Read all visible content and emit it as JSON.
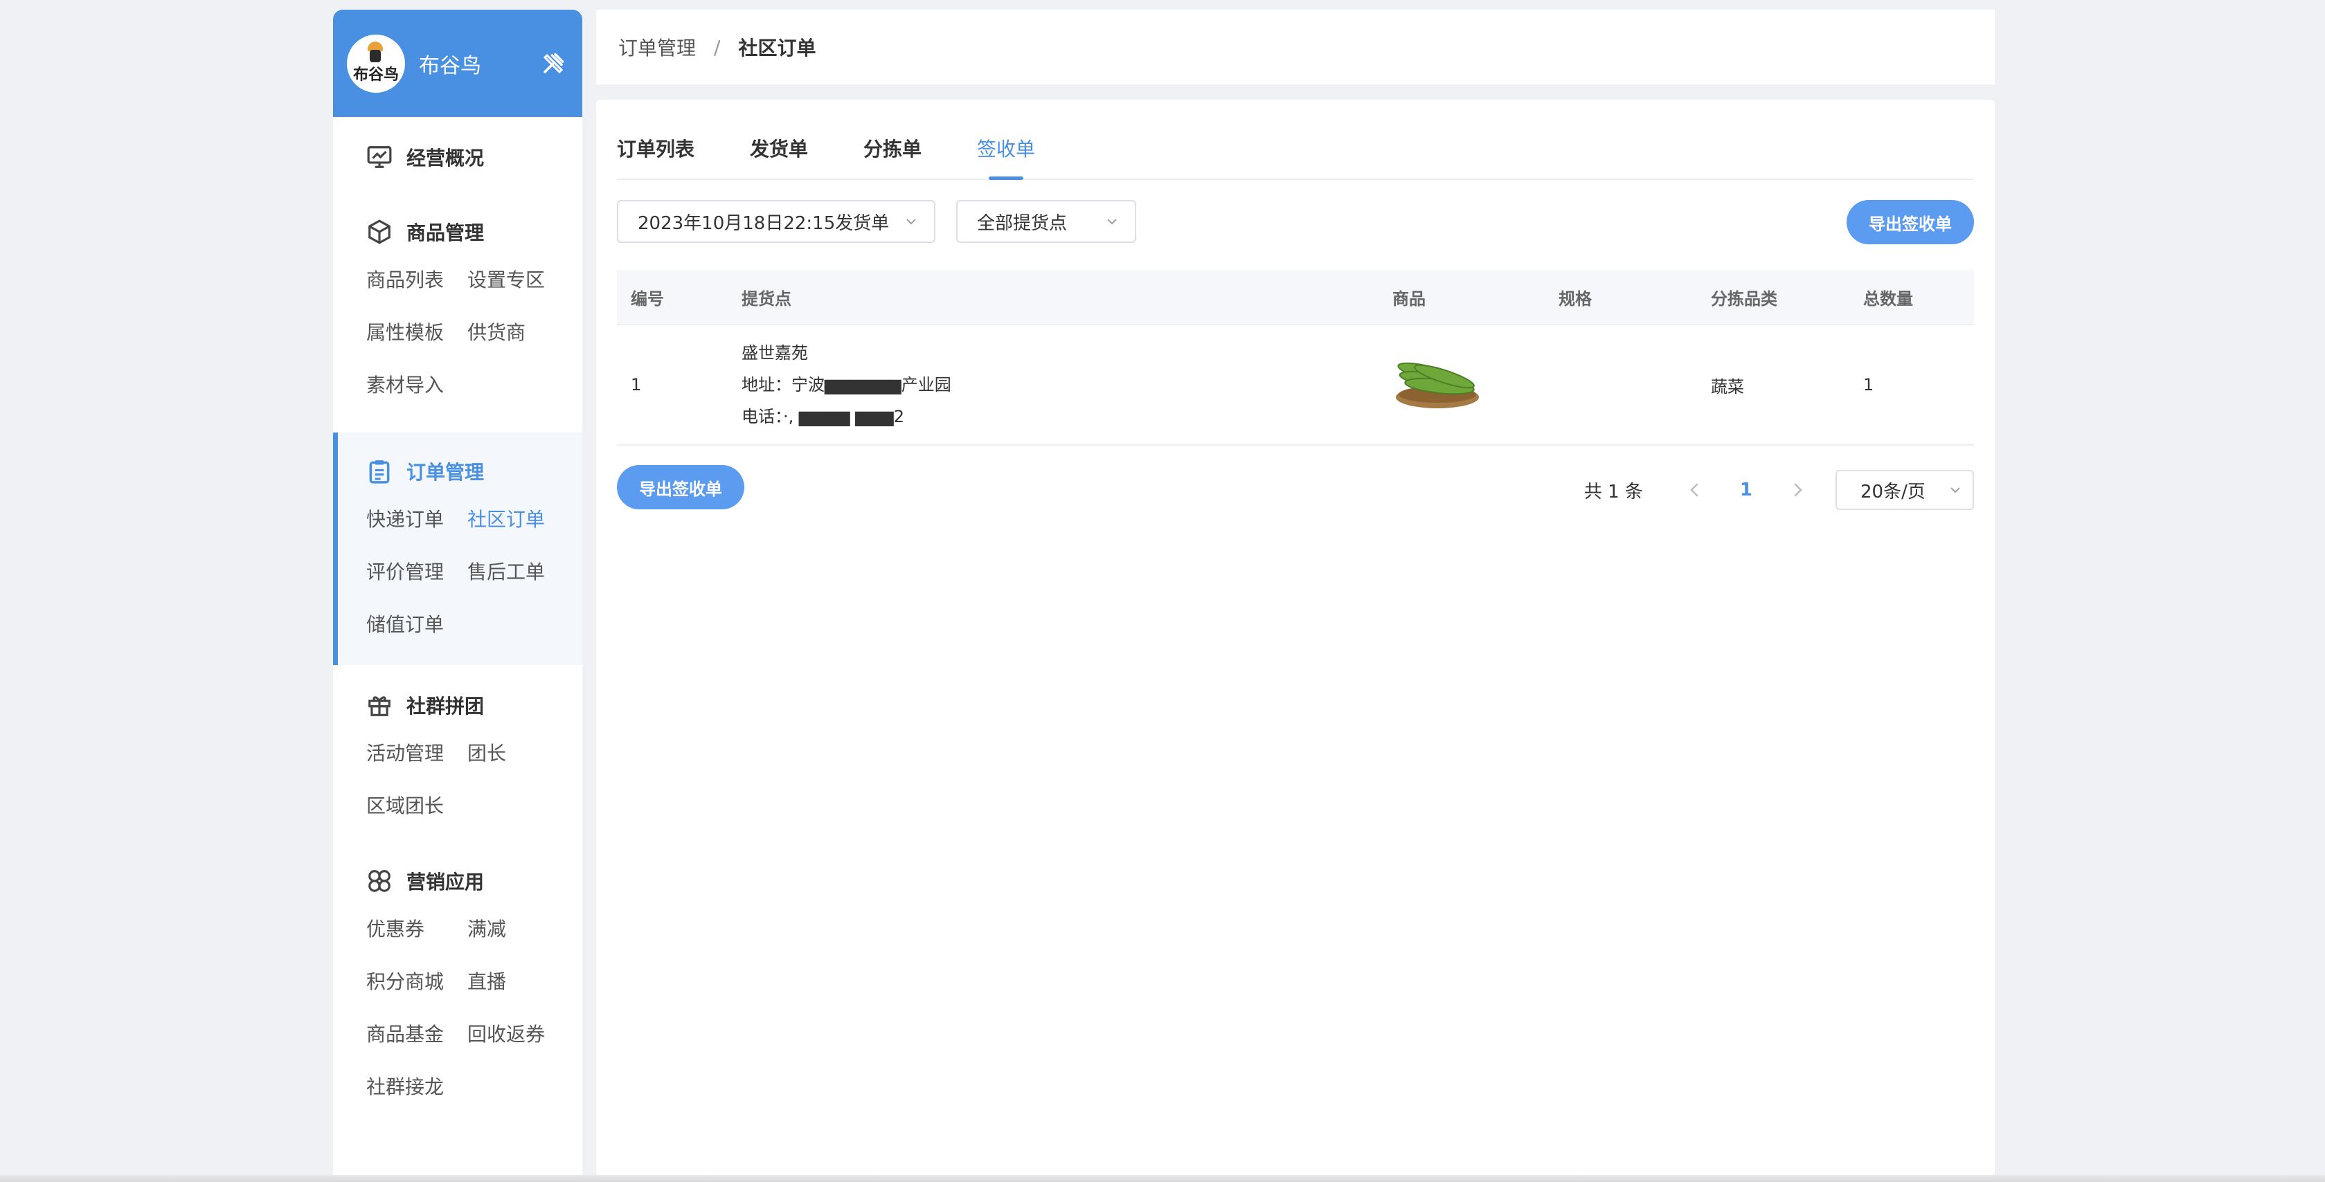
{
  "brand": {
    "name": "布谷鸟",
    "logo_text": "布谷鸟"
  },
  "sidebar": {
    "groups": [
      {
        "title": "经营概况",
        "icon": "monitor-chart-icon",
        "items": []
      },
      {
        "title": "商品管理",
        "icon": "box-icon",
        "items": [
          "商品列表",
          "设置专区",
          "属性模板",
          "供货商",
          "素材导入"
        ]
      },
      {
        "title": "订单管理",
        "icon": "clipboard-icon",
        "active": true,
        "items": [
          "快递订单",
          "社区订单",
          "评价管理",
          "售后工单",
          "储值订单"
        ],
        "active_item": "社区订单"
      },
      {
        "title": "社群拼团",
        "icon": "gift-icon",
        "items": [
          "活动管理",
          "团长",
          "区域团长"
        ]
      },
      {
        "title": "营销应用",
        "icon": "clover-icon",
        "items": [
          "优惠券",
          "满减",
          "积分商城",
          "直播",
          "商品基金",
          "回收返券",
          "社群接龙"
        ]
      }
    ]
  },
  "breadcrumb": {
    "parent": "订单管理",
    "separator": "/",
    "current": "社区订单"
  },
  "tabs": [
    {
      "label": "订单列表",
      "active": false
    },
    {
      "label": "发货单",
      "active": false
    },
    {
      "label": "分拣单",
      "active": false
    },
    {
      "label": "签收单",
      "active": true
    }
  ],
  "filters": {
    "shipment": "2023年10月18日22:15发货单",
    "pickup_point": "全部提货点",
    "export_label": "导出签收单"
  },
  "table": {
    "headers": [
      "编号",
      "提货点",
      "商品",
      "规格",
      "分拣品类",
      "总数量"
    ],
    "rows": [
      {
        "no": "1",
        "pickup_name": "盛世嘉苑",
        "pickup_address": "地址：宁波▆▆▆▆▆▆产业园",
        "pickup_phone": "电话：·,  ▆▆▆▆  ▆▆▆2",
        "product_image": "cucumber-image",
        "spec": "",
        "category": "蔬菜",
        "quantity": "1"
      }
    ]
  },
  "footer": {
    "export_label": "导出签收单",
    "total": "共 1 条",
    "current_page": "1",
    "page_size": "20条/页"
  },
  "colors": {
    "accent": "#4a90e2",
    "button": "#5b9cf0",
    "background": "#f0f1f5"
  }
}
